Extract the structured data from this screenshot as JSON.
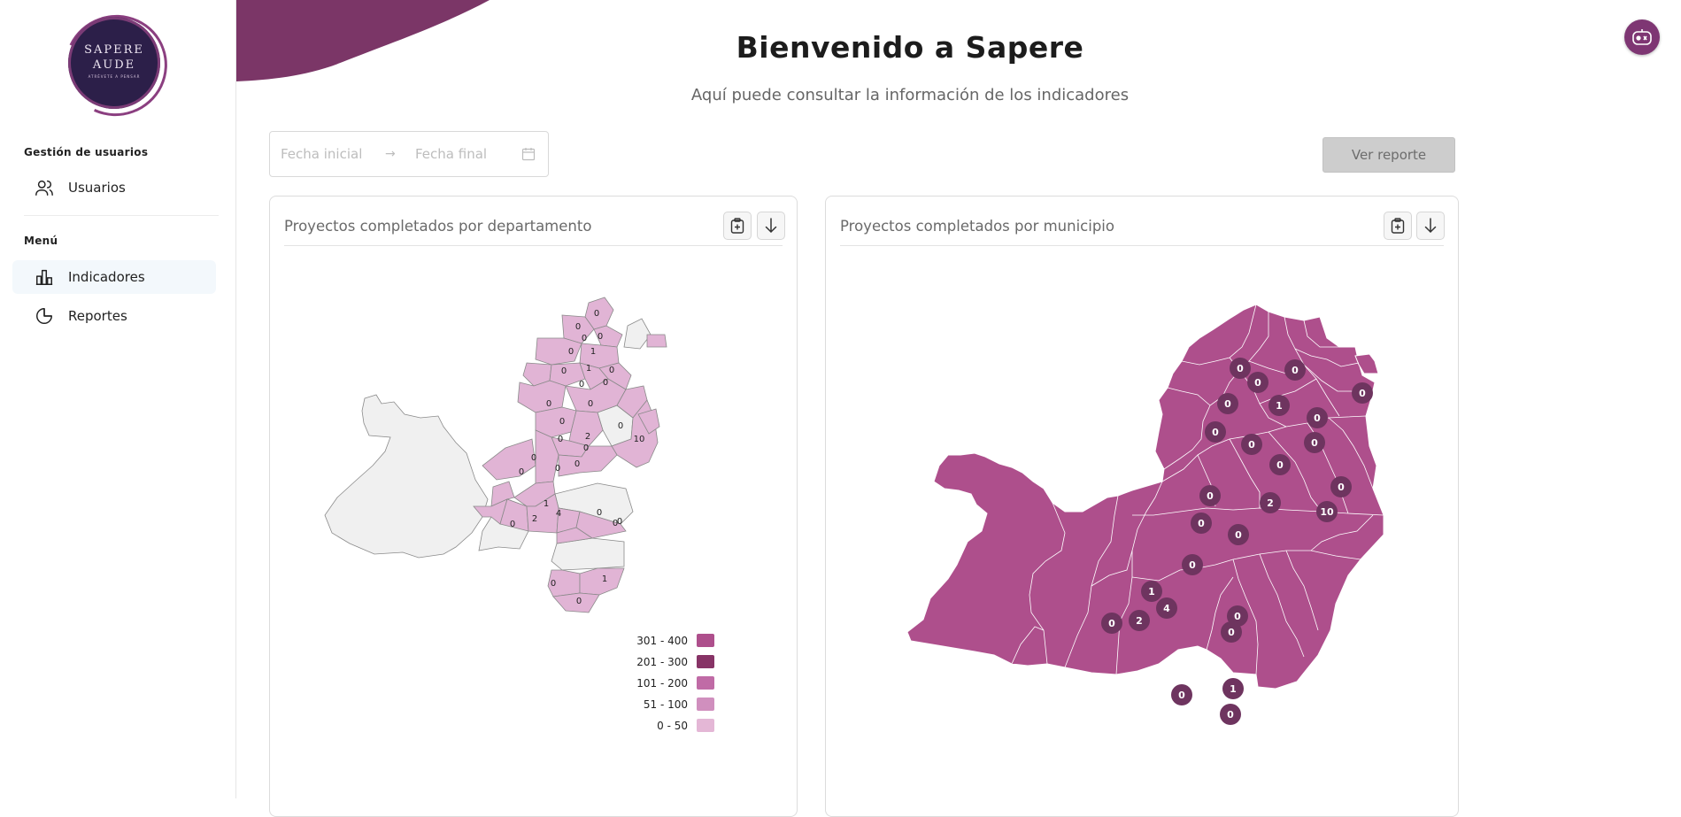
{
  "app": {
    "logo_line1": "SAPERE",
    "logo_line2": "AUDE",
    "logo_sub": "ATRÉVETE A PENSAR",
    "title": "Bienvenido a Sapere",
    "subtitle": "Aquí puede consultar la información de los indicadores"
  },
  "sidebar": {
    "section_users": "Gestión de usuarios",
    "users_label": "Usuarios",
    "section_menu": "Menú",
    "items": [
      {
        "label": "Indicadores",
        "icon": "bar-chart-icon",
        "active": true
      },
      {
        "label": "Reportes",
        "icon": "pie-chart-icon",
        "active": false
      }
    ]
  },
  "filters": {
    "start_placeholder": "Fecha inicial",
    "end_placeholder": "Fecha final",
    "report_button": "Ver reporte"
  },
  "colors": {
    "brand": "#7e3673",
    "map_dept_fill": "#e1b4d5",
    "map_muni_fill": "#ae4f8c",
    "map_empty": "#f0f0f0",
    "marker": "#6e345f"
  },
  "cards": [
    {
      "title": "Proyectos completados por departamento",
      "region_values": [
        "0",
        "0",
        "0",
        "0",
        "0",
        "1",
        "0",
        "1",
        "0",
        "0",
        "0",
        "0",
        "0",
        "0",
        "2",
        "0",
        "0",
        "0",
        "10",
        "0",
        "0",
        "0",
        "0",
        "1",
        "2",
        "4",
        "0",
        "0",
        "0",
        "0",
        "1",
        "0",
        "0"
      ],
      "legend": [
        {
          "label": "301 - 400",
          "color": "#ae4f8c"
        },
        {
          "label": "201 - 300",
          "color": "#873366"
        },
        {
          "label": "101 - 200",
          "color": "#c06ba6"
        },
        {
          "label": "51 - 100",
          "color": "#d08fbe"
        },
        {
          "label": "0 - 50",
          "color": "#e4b7d6"
        }
      ]
    },
    {
      "title": "Proyectos completados por municipio",
      "marker_values": [
        "0",
        "0",
        "0",
        "0",
        "0",
        "1",
        "0",
        "0",
        "0",
        "0",
        "0",
        "0",
        "0",
        "2",
        "10",
        "0",
        "0",
        "0",
        "1",
        "4",
        "2",
        "0",
        "0",
        "0",
        "0",
        "1",
        "0"
      ]
    }
  ]
}
